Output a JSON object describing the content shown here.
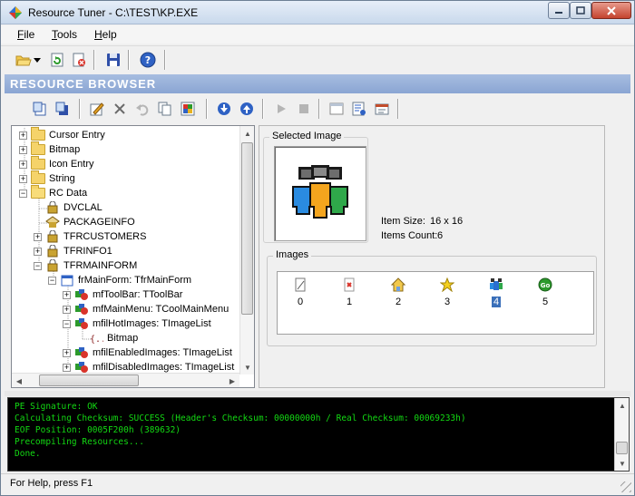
{
  "window": {
    "title": "Resource Tuner - C:\\TEST\\KP.EXE"
  },
  "menu": {
    "items": [
      {
        "label": "File"
      },
      {
        "label": "Tools"
      },
      {
        "label": "Help"
      }
    ]
  },
  "resource_browser": {
    "title": "RESOURCE BROWSER"
  },
  "tree": {
    "items": [
      {
        "label": "Cursor Entry",
        "expander": "+"
      },
      {
        "label": "Bitmap",
        "expander": "+"
      },
      {
        "label": "Icon Entry",
        "expander": "+"
      },
      {
        "label": "String",
        "expander": "+"
      },
      {
        "label": "RC Data",
        "expander": "−"
      },
      {
        "label": "DVCLAL",
        "expander": ""
      },
      {
        "label": "PACKAGEINFO",
        "expander": ""
      },
      {
        "label": "TFRCUSTOMERS",
        "expander": "+"
      },
      {
        "label": "TFRINFO1",
        "expander": "+"
      },
      {
        "label": "TFRMAINFORM",
        "expander": "−"
      },
      {
        "label": "frMainForm: TfrMainForm",
        "expander": "−"
      },
      {
        "label": "mfToolBar: TToolBar",
        "expander": "+"
      },
      {
        "label": "mfMainMenu: TCoolMainMenu",
        "expander": "+"
      },
      {
        "label": "mfilHotImages: TImageList",
        "expander": "−"
      },
      {
        "label": "Bitmap",
        "expander": ""
      },
      {
        "label": "mfilEnabledImages: TImageList",
        "expander": "+"
      },
      {
        "label": "mfilDisabledImages: TImageList",
        "expander": "+"
      }
    ]
  },
  "selected_image": {
    "group_label": "Selected Image",
    "item_size_label": "Item Size:",
    "item_size": "16 x 16",
    "items_count_label": "Items Count:",
    "items_count": "6"
  },
  "images": {
    "group_label": "Images",
    "items": [
      {
        "index": "0",
        "icon": "page-icon"
      },
      {
        "index": "1",
        "icon": "delete-page-icon"
      },
      {
        "index": "2",
        "icon": "home-icon"
      },
      {
        "index": "3",
        "icon": "star-icon"
      },
      {
        "index": "4",
        "icon": "people-icon"
      },
      {
        "index": "5",
        "icon": "go-icon"
      }
    ],
    "selected": "4"
  },
  "console": {
    "lines": [
      "PE Signature: OK",
      "Calculating Checksum: SUCCESS (Header's Checksum: 00000000h / Real Checksum: 00069233h)",
      "EOF Position: 0005F200h  (389632)",
      "Precompiling Resources...",
      "Done."
    ]
  },
  "status": {
    "text": "For Help, press F1"
  },
  "colors": {
    "console_text": "#13d913",
    "header_bg": "#8aa5d3",
    "selection": "#3a6fb9"
  }
}
